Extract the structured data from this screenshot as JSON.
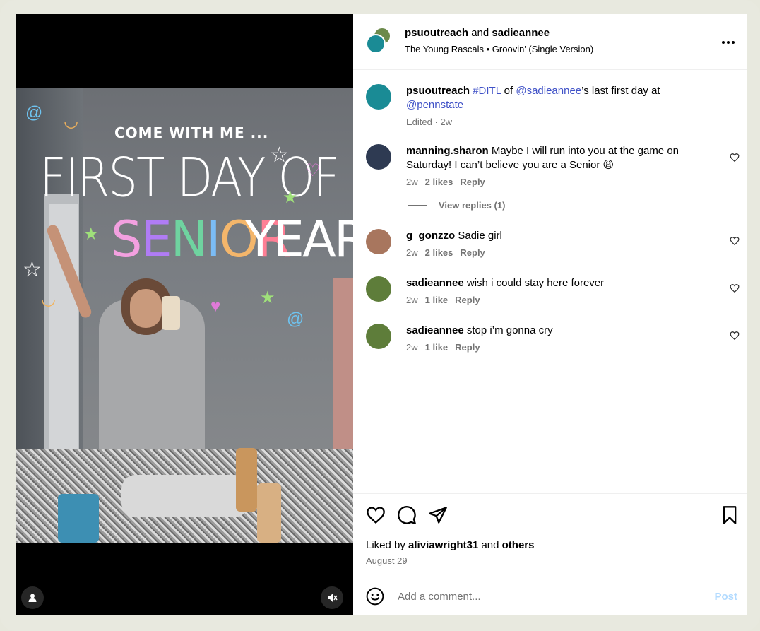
{
  "header": {
    "user1": "psuoutreach",
    "and_text": "and",
    "user2": "sadieannee",
    "audio": "The Young Rascals • Groovin' (Single Version)"
  },
  "media": {
    "overlay_small": "COME WITH ME ...",
    "overlay_big": "FIRST DAY OF",
    "overlay_senior": [
      "S",
      "E",
      "N",
      "I",
      "O",
      "R"
    ],
    "overlay_senior_colors": [
      "#f3a0e0",
      "#b07cf5",
      "#6fd3a0",
      "#7bbcf5",
      "#f4b66b",
      "#ff7f95"
    ],
    "overlay_year": "YEAR"
  },
  "caption": {
    "user": "psuoutreach",
    "hashtag": "#DITL",
    "of": "of",
    "mention1": "@sadieannee",
    "rest": "’s last first day at",
    "mention2": "@pennstate",
    "meta": "Edited · 2w"
  },
  "comments": [
    {
      "user": "manning.sharon",
      "text": "Maybe I will run into you at the game on Saturday! I can’t believe you are a Senior 😩",
      "time": "2w",
      "likes": "2 likes",
      "reply": "Reply",
      "view_replies": "View replies (1)",
      "avatar_color": "#2e3a52"
    },
    {
      "user": "g_gonzzo",
      "text": "Sadie girl",
      "time": "2w",
      "likes": "2 likes",
      "reply": "Reply",
      "avatar_color": "#a8765e"
    },
    {
      "user": "sadieannee",
      "text": "wish i could stay here forever",
      "time": "2w",
      "likes": "1 like",
      "reply": "Reply",
      "avatar_color": "#5e7d3a"
    },
    {
      "user": "sadieannee",
      "text": "stop i’m gonna cry",
      "time": "2w",
      "likes": "1 like",
      "reply": "Reply",
      "avatar_color": "#5e7d3a"
    }
  ],
  "footer": {
    "liked_by_prefix": "Liked by",
    "liked_by_user": "aliviawright31",
    "liked_and": "and",
    "liked_others": "others",
    "date": "August 29",
    "comment_placeholder": "Add a comment...",
    "post_label": "Post"
  },
  "icons": {
    "more": "more-options-icon",
    "like": "heart-icon",
    "comment": "comment-icon",
    "share": "share-icon",
    "save": "bookmark-icon",
    "emoji": "emoji-icon",
    "user_tag": "user-tag-icon",
    "mute": "muted-speaker-icon"
  },
  "colors": {
    "link": "#3f51c7",
    "muted": "#737373",
    "post_disabled": "#b3dbff"
  }
}
